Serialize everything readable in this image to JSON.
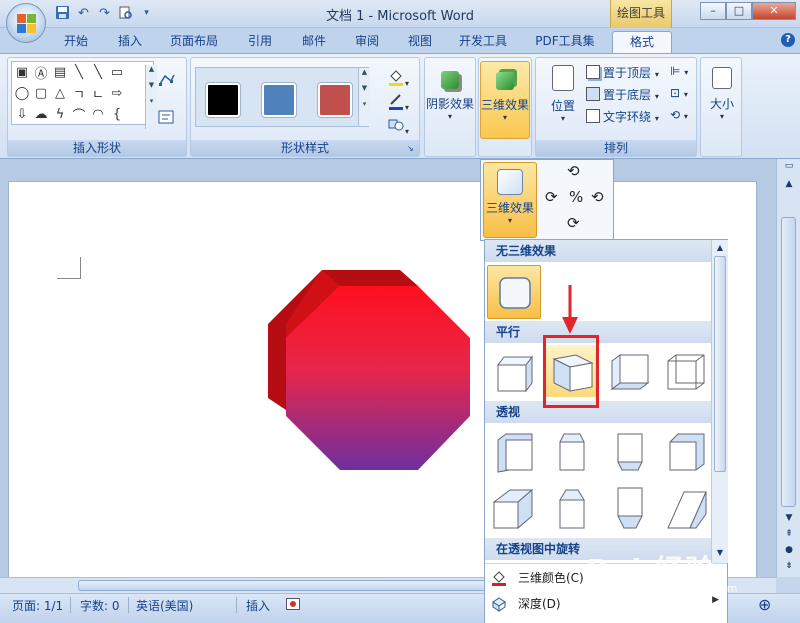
{
  "window": {
    "title": "文档 1 - Microsoft Word",
    "context_tab_title": "绘图工具",
    "buttons": {
      "minimize": "–",
      "maximize": "□",
      "close": "✕"
    }
  },
  "quick_access": [
    "save-icon",
    "undo-icon",
    "redo-icon",
    "print-preview-icon"
  ],
  "tabs": [
    {
      "label": "开始"
    },
    {
      "label": "插入"
    },
    {
      "label": "页面布局"
    },
    {
      "label": "引用"
    },
    {
      "label": "邮件"
    },
    {
      "label": "审阅"
    },
    {
      "label": "视图"
    },
    {
      "label": "开发工具"
    },
    {
      "label": "PDF工具集"
    },
    {
      "label": "格式",
      "active": true
    }
  ],
  "ribbon": {
    "insert_shapes": {
      "label": "插入形状"
    },
    "shape_styles": {
      "label": "形状样式",
      "swatches": [
        "#000000",
        "#4f81bd",
        "#c0504d"
      ]
    },
    "shadow": {
      "label": "阴影效果"
    },
    "threed": {
      "label": "三维效果"
    },
    "arrange": {
      "label": "排列",
      "position": "位置",
      "bring_front": "置于顶层",
      "send_back": "置于底层",
      "wrap_text": "文字环绕"
    },
    "size": {
      "label": "大小"
    }
  },
  "threed_popout": {
    "button_label": "三维效果"
  },
  "gallery": {
    "sections": {
      "none": "无三维效果",
      "parallel": "平行",
      "perspective": "透视",
      "rotate_perspective": "在透视图中旋转"
    },
    "menu": [
      {
        "label": "三维颜色(C)",
        "icon": "paint-bucket-icon",
        "submenu": false
      },
      {
        "label": "深度(D)",
        "icon": "depth-icon",
        "submenu": true
      }
    ]
  },
  "status": {
    "page": "页面: 1/1",
    "words": "字数: 0",
    "language": "英语(美国)",
    "mode": "插入"
  },
  "watermark": {
    "text": "Bai 经验",
    "sub": "jingyan.baidu.com"
  }
}
